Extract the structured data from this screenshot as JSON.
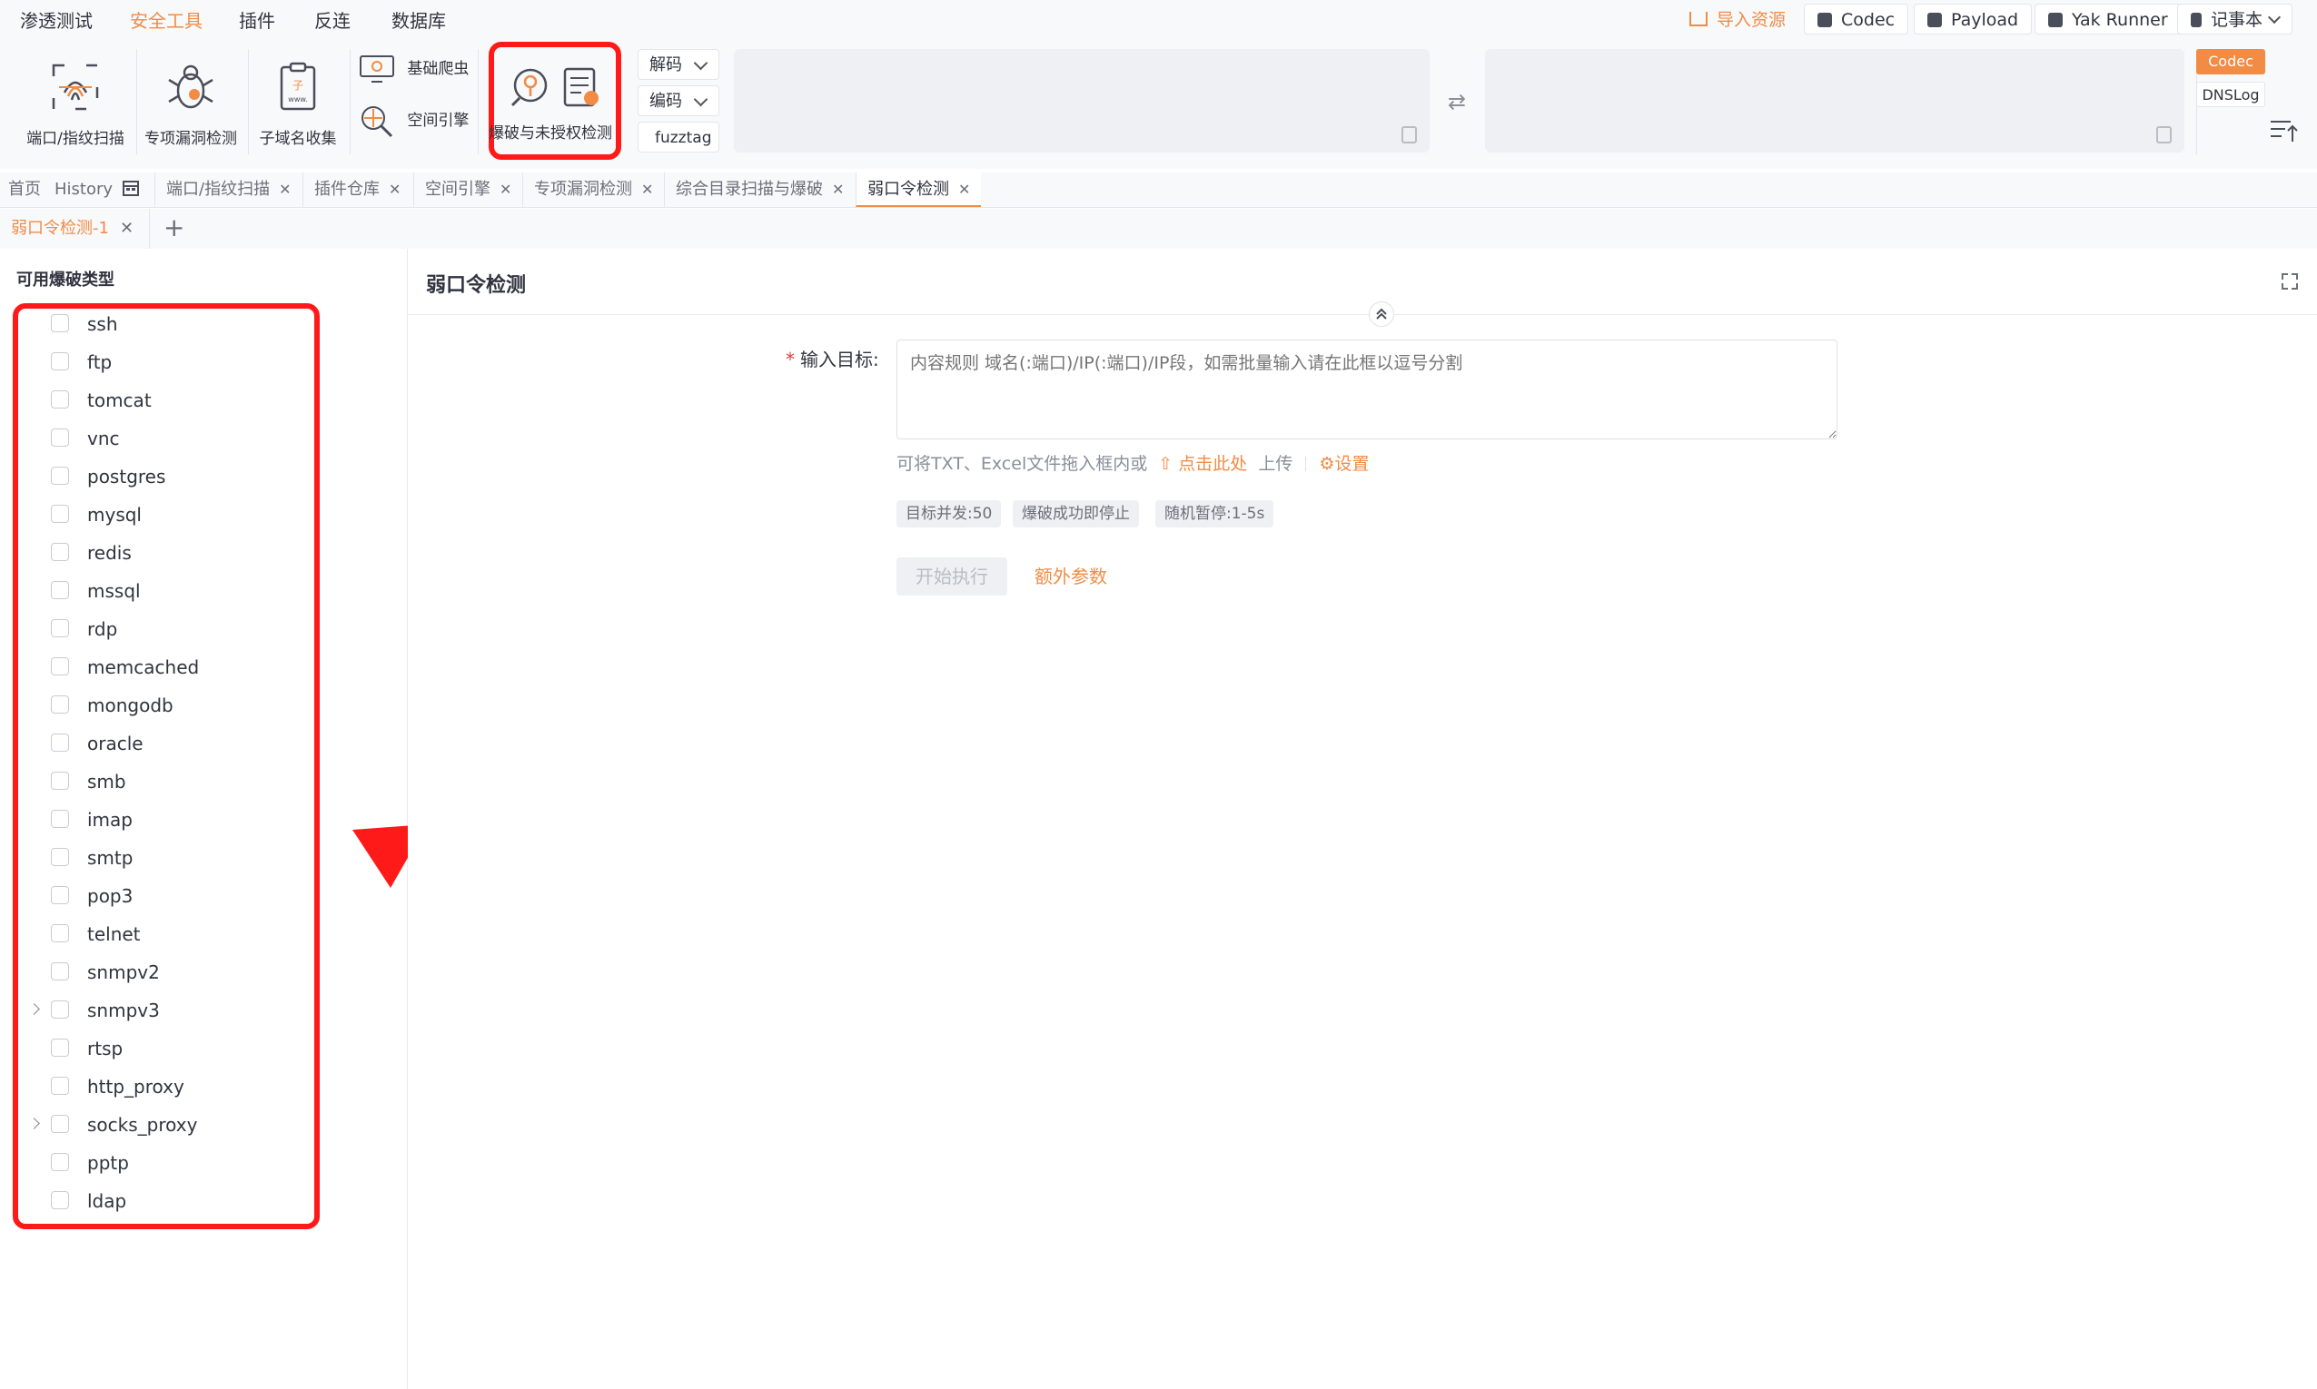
{
  "menu": {
    "items": [
      "渗透测试",
      "安全工具",
      "插件",
      "反连",
      "数据库"
    ],
    "active_index": 1
  },
  "topbar": {
    "import_label": "导入资源",
    "codec_label": "Codec",
    "payload_label": "Payload",
    "yak_runner_label": "Yak Runner",
    "notebook_label": "记事本"
  },
  "toolbar": {
    "port_scan": "端口/指纹扫描",
    "vuln_detect": "专项漏洞检测",
    "subdomain": "子域名收集",
    "basic_crawler": "基础爬虫",
    "space_engine": "空间引擎",
    "brute_force": "爆破与未授权检测",
    "decode_label": "解码",
    "encode_label": "编码",
    "fuzztag_label": "fuzztag",
    "codec_tab": "Codec",
    "dnslog_tab": "DNSLog"
  },
  "tabs": {
    "home": "首页",
    "history": "History",
    "items": [
      "端口/指纹扫描",
      "插件仓库",
      "空间引擎",
      "专项漏洞检测",
      "综合目录扫描与爆破",
      "弱口令检测"
    ],
    "active_index": 5
  },
  "subtab": {
    "label": "弱口令检测-1",
    "add": "+"
  },
  "left": {
    "title": "可用爆破类型",
    "types": [
      {
        "name": "ssh",
        "expandable": false
      },
      {
        "name": "ftp",
        "expandable": false
      },
      {
        "name": "tomcat",
        "expandable": false
      },
      {
        "name": "vnc",
        "expandable": false
      },
      {
        "name": "postgres",
        "expandable": false
      },
      {
        "name": "mysql",
        "expandable": false
      },
      {
        "name": "redis",
        "expandable": false
      },
      {
        "name": "mssql",
        "expandable": false
      },
      {
        "name": "rdp",
        "expandable": false
      },
      {
        "name": "memcached",
        "expandable": false
      },
      {
        "name": "mongodb",
        "expandable": false
      },
      {
        "name": "oracle",
        "expandable": false
      },
      {
        "name": "smb",
        "expandable": false
      },
      {
        "name": "imap",
        "expandable": false
      },
      {
        "name": "smtp",
        "expandable": false
      },
      {
        "name": "pop3",
        "expandable": false
      },
      {
        "name": "telnet",
        "expandable": false
      },
      {
        "name": "snmpv2",
        "expandable": false
      },
      {
        "name": "snmpv3",
        "expandable": true
      },
      {
        "name": "rtsp",
        "expandable": false
      },
      {
        "name": "http_proxy",
        "expandable": false
      },
      {
        "name": "socks_proxy",
        "expandable": true
      },
      {
        "name": "pptp",
        "expandable": false
      },
      {
        "name": "ldap",
        "expandable": false
      }
    ]
  },
  "main": {
    "title": "弱口令检测",
    "target_label": "输入目标:",
    "required_mark": "*",
    "target_placeholder": "内容规则 域名(:端口)/IP(:端口)/IP段，如需批量输入请在此框以逗号分割",
    "hint_prefix": "可将TXT、Excel文件拖入框内或",
    "hint_link": "点击此处",
    "hint_suffix": "上传",
    "settings_label": "设置",
    "tags": [
      "目标并发:50",
      "爆破成功即停止",
      "随机暂停:1-5s"
    ],
    "start_button": "开始执行",
    "extra_params": "额外参数"
  },
  "colors": {
    "accent": "#f28b44",
    "annotation_red": "#ff1a1a"
  }
}
